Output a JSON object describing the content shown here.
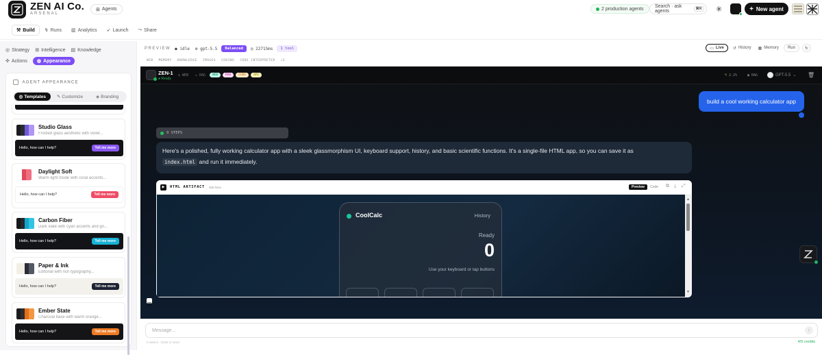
{
  "header": {
    "app_title": "ZEN AI Co.",
    "app_subtitle": "ARSENAL",
    "agents_button": "Agents",
    "production_status": "2 production agents",
    "search_placeholder": "Search · ask agents",
    "search_shortcut": "⌘K",
    "new_agent_button": "New agent"
  },
  "mode_tabs": [
    {
      "label": "Build",
      "icon": "hammer-icon",
      "active": true
    },
    {
      "label": "Runs",
      "icon": "run-icon",
      "active": false
    },
    {
      "label": "Analytics",
      "icon": "analytics-icon",
      "active": false
    },
    {
      "label": "Launch",
      "icon": "rocket-icon",
      "active": false
    },
    {
      "label": "Share",
      "icon": "share-icon",
      "active": false
    }
  ],
  "left_nav": [
    {
      "label": "Strategy",
      "active": false
    },
    {
      "label": "Intelligence",
      "active": false
    },
    {
      "label": "Knowledge",
      "active": false
    },
    {
      "label": "Actions",
      "active": false
    },
    {
      "label": "Appearance",
      "active": true
    }
  ],
  "appearance": {
    "section_title": "AGENT APPEARANCE",
    "segments": [
      "Templates",
      "Customize",
      "Branding"
    ],
    "active_segment": "Templates",
    "templates": [
      {
        "name": "Studio Glass",
        "desc": "Frosted glass aesthetic with violet...",
        "colors": [
          "#1a1a1f",
          "#2b2b33",
          "#6d5cd6",
          "#b195f5"
        ],
        "preview_bg": "#141416",
        "hello_color": "#ffffff",
        "button_color": "#8a57f2",
        "hello": "Hello, how can I help?",
        "cta": "Tell me more"
      },
      {
        "name": "Daylight Soft",
        "desc": "Warm light mode with coral accents...",
        "colors": [
          "#ffffff",
          "#ffffff",
          "#e04a5d",
          "#f06f80"
        ],
        "preview_bg": "#ffffff",
        "hello_color": "#333333",
        "button_color": "#ef4c64",
        "hello": "Hello, how can I help?",
        "cta": "Tell me more"
      },
      {
        "name": "Carbon Fiber",
        "desc": "Dark slate with cyan accents and gri...",
        "colors": [
          "#16171b",
          "#25272d",
          "#14a6c9",
          "#32c3e2"
        ],
        "preview_bg": "#131418",
        "hello_color": "#ffffff",
        "button_color": "#17b2d4",
        "hello": "Hello, how can I help?",
        "cta": "Tell me more"
      },
      {
        "name": "Paper & Ink",
        "desc": "Editorial with rich typography...",
        "colors": [
          "#f3efe6",
          "#f3efe6",
          "#2a2d36",
          "#545864"
        ],
        "preview_bg": "#f3f1ec",
        "hello_color": "#333333",
        "button_color": "#1d2232",
        "hello": "Hello, how can I help?",
        "cta": "Tell me more"
      },
      {
        "name": "Ember State",
        "desc": "Charcoal base with warm orange...",
        "colors": [
          "#1b1b1d",
          "#2c2c2f",
          "#e57019",
          "#f39642"
        ],
        "preview_bg": "#151517",
        "hello_color": "#ffffff",
        "button_color": "#f07b25",
        "hello": "Hello, how can I help?",
        "cta": "Tell me more"
      }
    ]
  },
  "preview_bar": {
    "label": "PREVIEW",
    "status": "idle",
    "model": "gpt-5.5",
    "mode_chip": "Balanced",
    "latency": "22715ms",
    "tools_chip": "1 tool",
    "tags": [
      "WEB",
      "MEMORY",
      "KNOWLEDGE",
      "IMAGES",
      "CODING",
      "CODE INTERPRETER",
      "+2"
    ],
    "live_btn": "Live",
    "history_btn": "History",
    "memory_btn": "Memory",
    "run_btn": "Run"
  },
  "chat_header": {
    "agent_name": "ZEN-1",
    "agent_status": "Ready",
    "web_label": "WEB",
    "rag_label": "RAG",
    "badges": [
      {
        "label": "WEB",
        "color": "#2bd9b0"
      },
      {
        "label": "RAG",
        "color": "#e25cc7"
      },
      {
        "label": "CODE",
        "color": "#f2a53a"
      },
      {
        "label": "API",
        "color": "#e8d54a"
      }
    ],
    "stat_one": "2.2%",
    "stat_two": "RAG",
    "model": "GPT-5.5"
  },
  "chat": {
    "user_message": "build a cool working calculator app",
    "steps_label": "9 STEPS",
    "response_part1": "Here's a polished, fully working calculator app with a sleek glassmorphism UI, keyboard support, history, and basic scientific functions. It's a single-file HTML app, so you can save it as",
    "response_code": "index.html",
    "response_part2": "and run it immediately."
  },
  "artifact": {
    "label": "HTML ARTIFACT",
    "meta": "458 lines",
    "preview_btn": "Preview",
    "code_btn": "Code",
    "calc": {
      "title": "CoolCalc",
      "history": "History",
      "status": "Ready",
      "display": "0",
      "hint": "Use your keyboard or tap buttons"
    }
  },
  "composer": {
    "placeholder": "Message...",
    "credits": "4/5 credits",
    "left_hint": "0 tokens · Enter to send"
  }
}
